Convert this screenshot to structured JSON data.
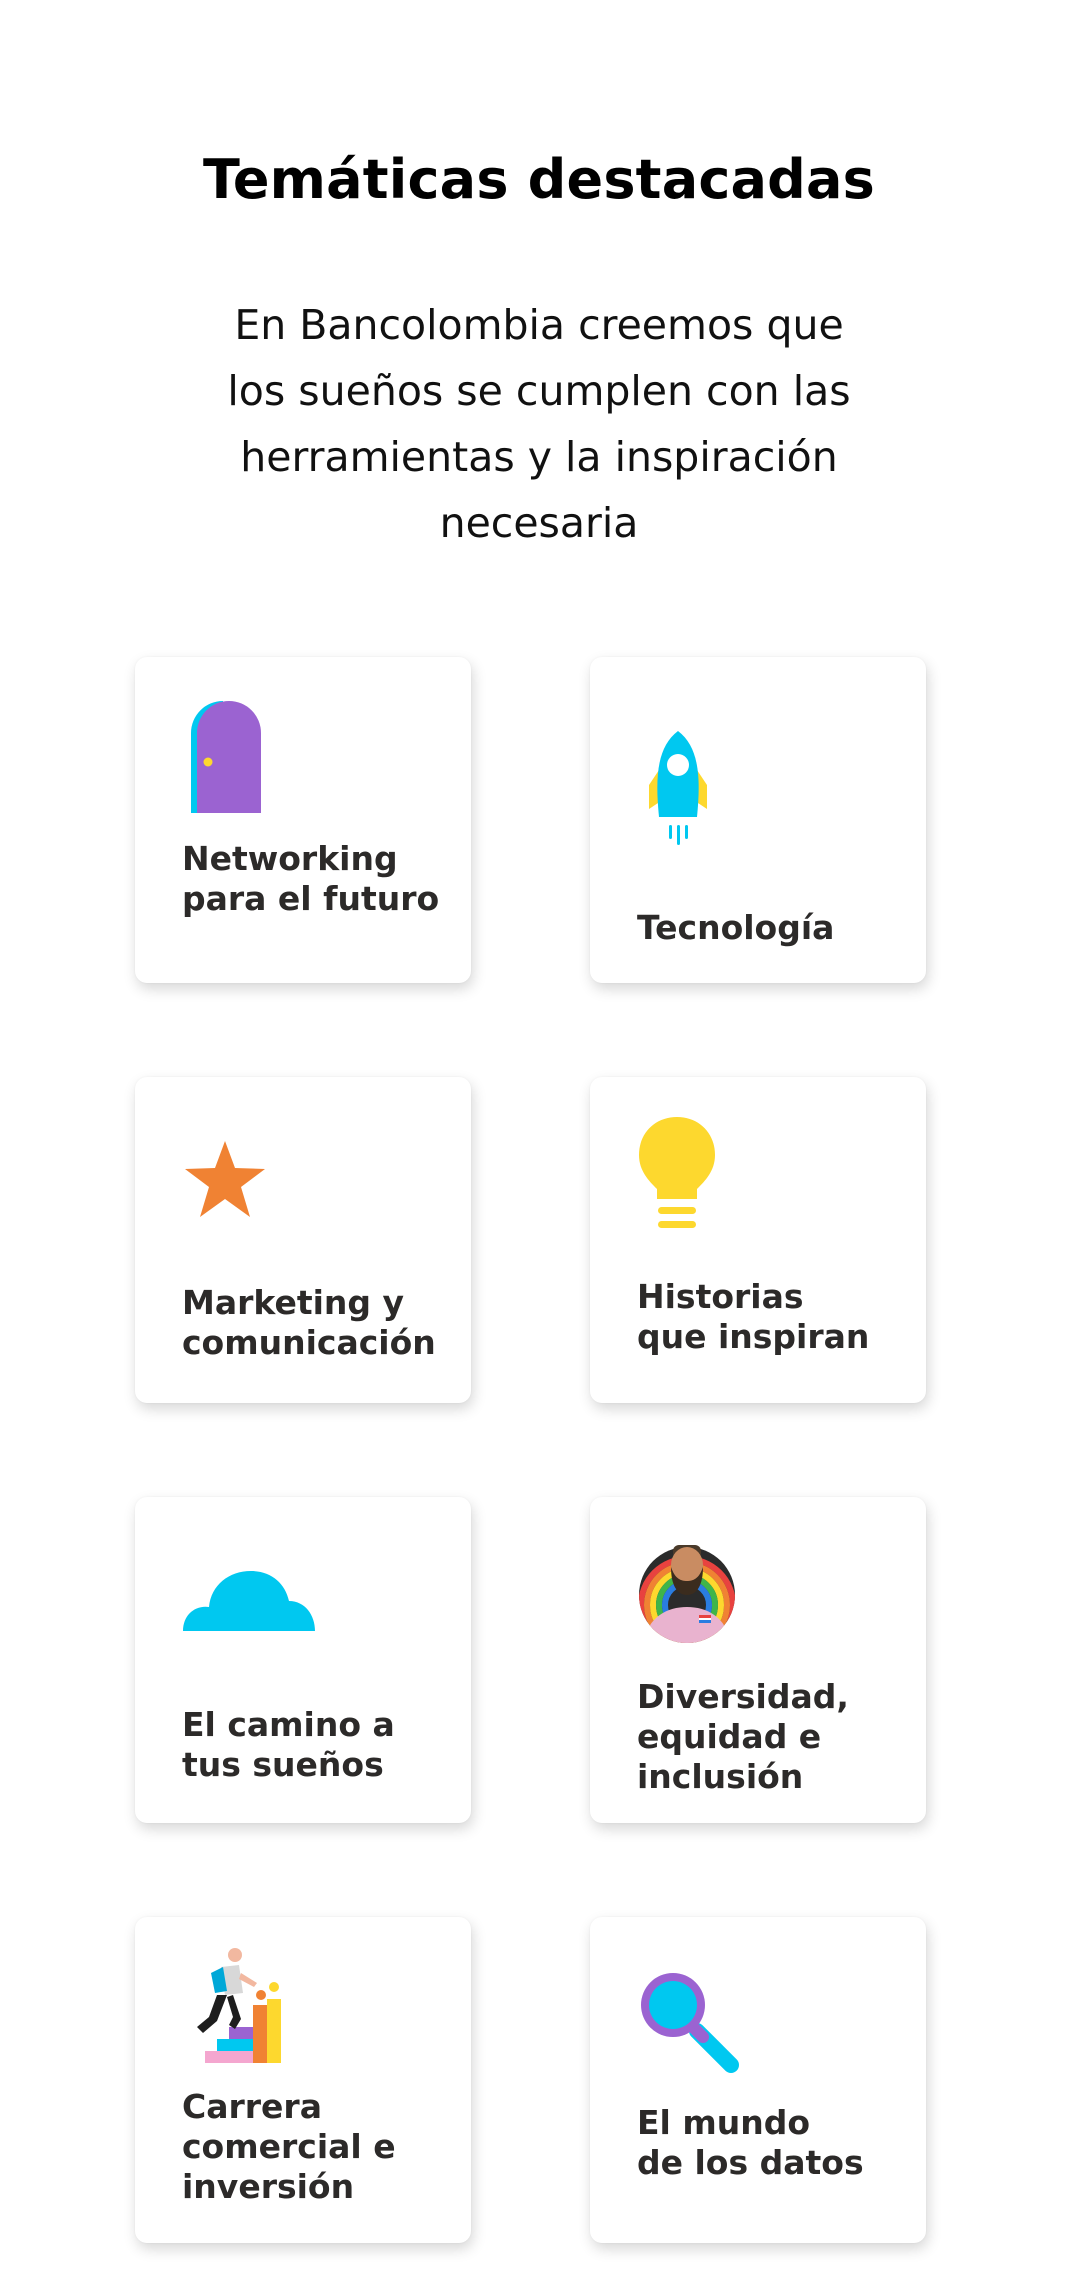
{
  "header": {
    "title": "Temáticas destacadas",
    "intro": "En Bancolombia creemos que los sueños se cumplen con las herramientas y la inspiración necesaria"
  },
  "topics": [
    {
      "label": "Networking\npara el futuro",
      "icon": "door-icon"
    },
    {
      "label": "Tecnología",
      "icon": "rocket-icon"
    },
    {
      "label": "Marketing y\ncomunicación",
      "icon": "star-icon"
    },
    {
      "label": "Historias\nque inspiran",
      "icon": "lightbulb-icon"
    },
    {
      "label": "El camino a\ntus sueños",
      "icon": "cloud-icon"
    },
    {
      "label": "Diversidad,\nequidad e\ninclusión",
      "icon": "diversity-avatar-icon"
    },
    {
      "label": "Carrera\ncomercial e\ninversión",
      "icon": "career-climber-icon"
    },
    {
      "label": "El mundo\nde los datos",
      "icon": "magnifier-icon"
    }
  ],
  "colors": {
    "purple": "#9b63d1",
    "cyan": "#00c8f0",
    "yellow": "#fdd82e",
    "orange": "#f08233",
    "label": "#2c2a29"
  }
}
